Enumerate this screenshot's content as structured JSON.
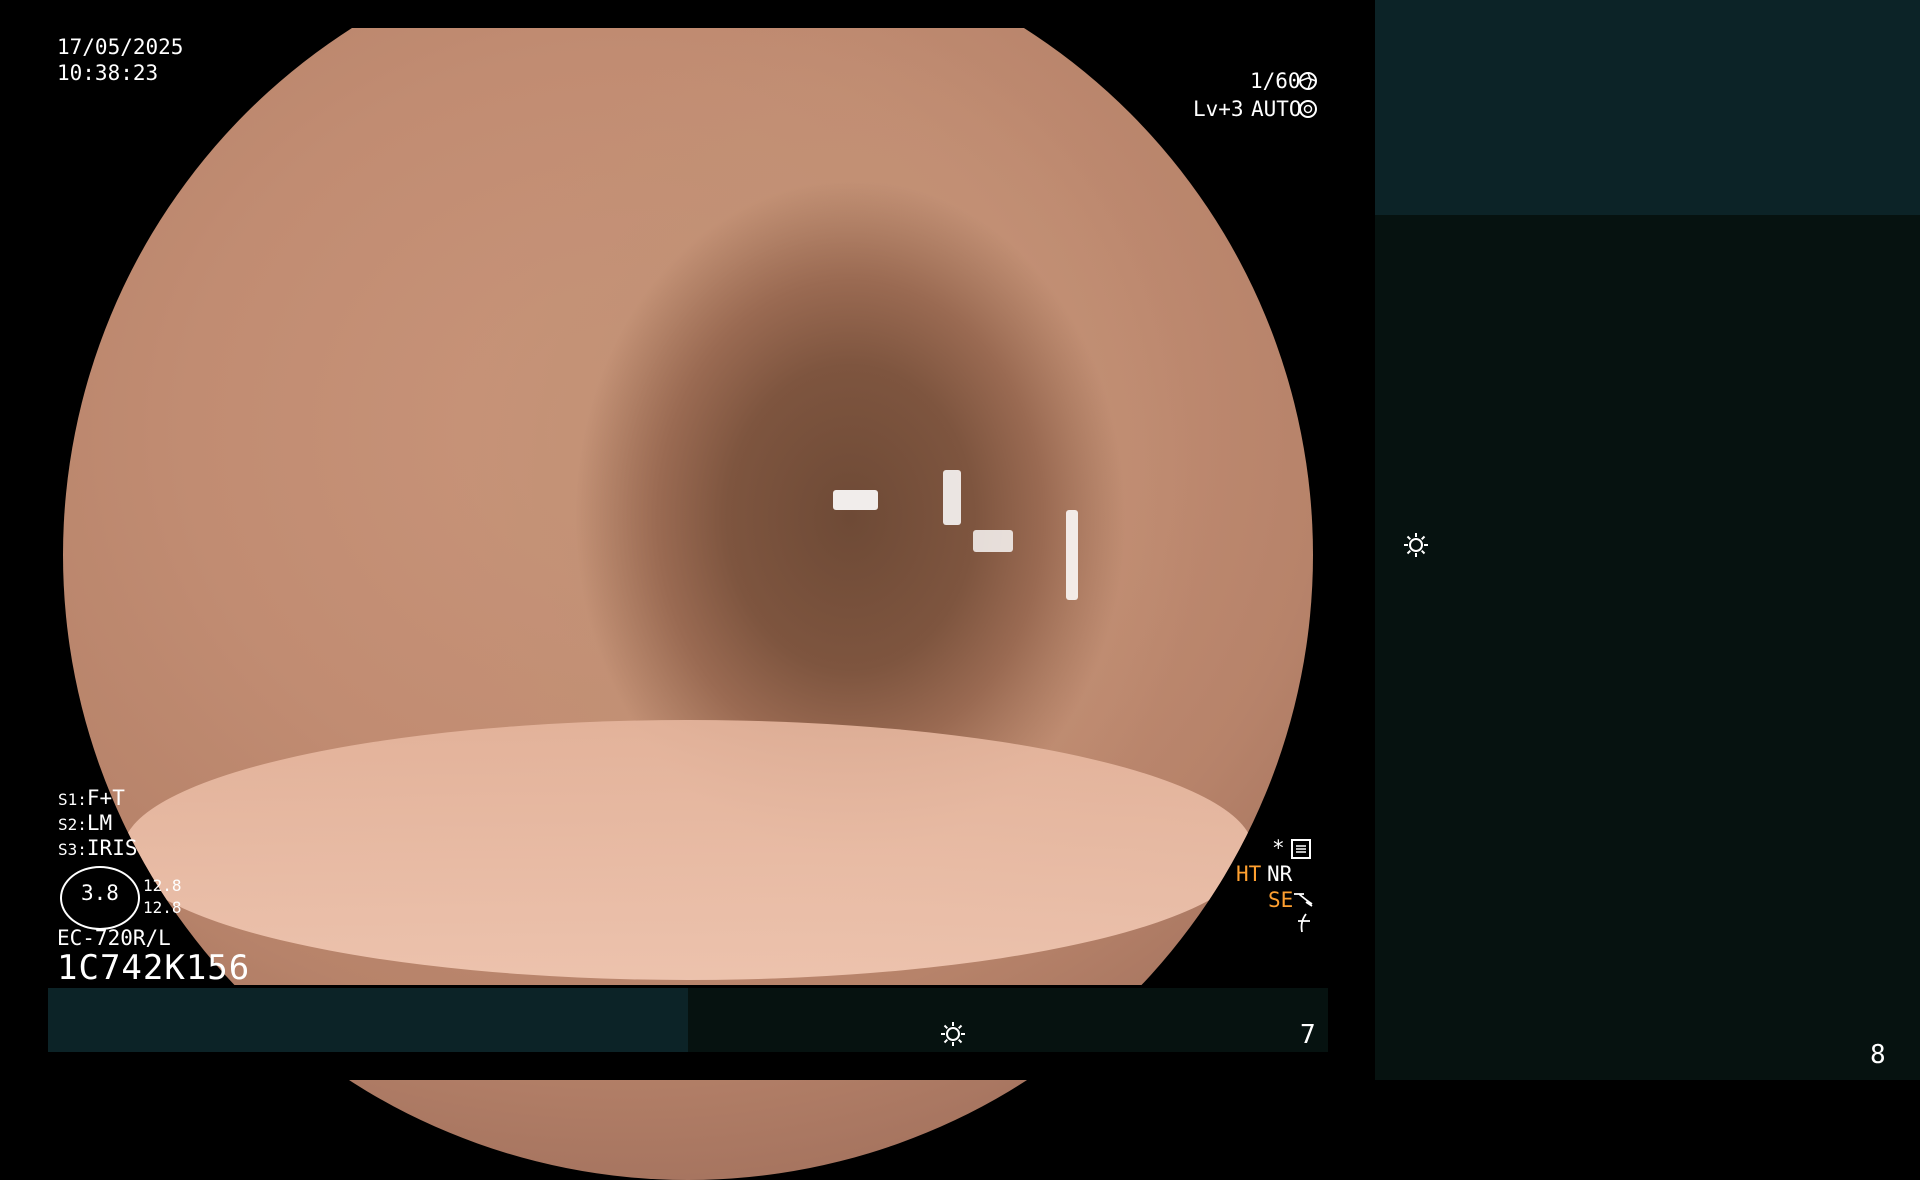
{
  "overlay": {
    "date": "17/05/2025",
    "time": "10:38:23",
    "shutter": "1/60",
    "level": "Lv+3",
    "iris_mode": "AUTO",
    "s1_label": "S1:",
    "s1_value": "F+T",
    "s2_label": "S2:",
    "s2_value": "LM",
    "s3_label": "S3:",
    "s3_value": "IRIS",
    "gauge_value": "3.8",
    "gauge_top": "12.8",
    "gauge_bottom": "12.8",
    "scope_model": "EC-720R/L",
    "serial": "1C742K156",
    "asterisk": "*",
    "ht": "HT",
    "nr": "NR",
    "se": "SE",
    "bottom_count": "7",
    "panel_count": "8"
  },
  "icons": {
    "shutter_icon": "aperture-icon",
    "iris_icon": "iris-icon",
    "settings_icon": "settings-box-icon",
    "se_icon": "enhance-icon",
    "filter_icon": "filter-icon",
    "brightness_icon": "sun-icon"
  },
  "colors": {
    "panel_top": "#0c2327",
    "panel_main": "#061210",
    "accent_orange": "#ffa030"
  }
}
